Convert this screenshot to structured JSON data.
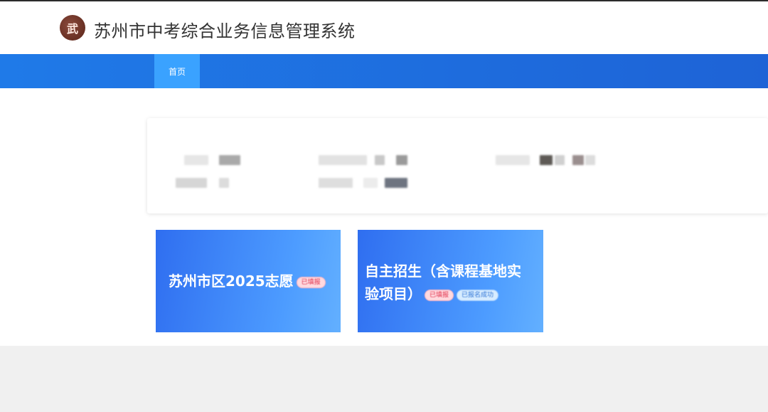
{
  "header": {
    "logo_text": "武",
    "title": "苏州市中考综合业务信息管理系统"
  },
  "nav": {
    "tabs": [
      {
        "label": "首页"
      }
    ]
  },
  "tiles": [
    {
      "title": "苏州市区2025志愿",
      "badges": [
        "已填报"
      ]
    },
    {
      "title_line1": "自主招生（含课程基地实",
      "title_line2": "验项目）",
      "badges": [
        "已填报",
        "已报名成功"
      ]
    }
  ],
  "colors": {
    "navbar": "#1e6ee0",
    "active_tab": "#3aa2ff",
    "tile_start": "#2f6ef0",
    "tile_end": "#63b0ff"
  }
}
